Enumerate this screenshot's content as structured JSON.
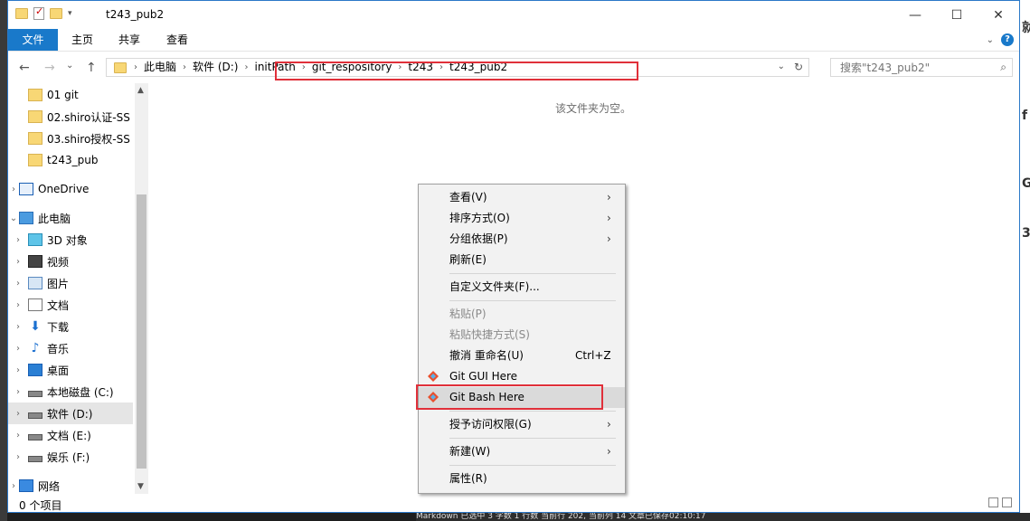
{
  "window": {
    "title": "t243_pub2",
    "controls": {
      "minimize": "—",
      "maximize": "☐",
      "close": "✕"
    }
  },
  "ribbon": {
    "tabs": [
      "文件",
      "主页",
      "共享",
      "查看"
    ],
    "expand_icon": "chevron-down-icon",
    "help_icon": "?"
  },
  "nav": {
    "back": "←",
    "forward": "→",
    "recent": "⌄",
    "up": "↑"
  },
  "address": {
    "crumbs": [
      "此电脑",
      "软件 (D:)",
      "initPath",
      "git_respository",
      "t243",
      "t243_pub2"
    ],
    "highlight_color": "#e0303a"
  },
  "search": {
    "placeholder": "搜索\"t243_pub2\""
  },
  "navpane": {
    "items": [
      {
        "label": "01 git",
        "icon": "folder-icon"
      },
      {
        "label": "02.shiro认证-SS",
        "icon": "folder-icon"
      },
      {
        "label": "03.shiro授权-SS",
        "icon": "folder-icon"
      },
      {
        "label": "t243_pub",
        "icon": "folder-icon"
      },
      {
        "label": "OneDrive",
        "icon": "cloud-icon"
      },
      {
        "label": "此电脑",
        "icon": "computer-icon"
      },
      {
        "label": "3D 对象",
        "icon": "3d-objects-icon"
      },
      {
        "label": "视频",
        "icon": "video-icon"
      },
      {
        "label": "图片",
        "icon": "pictures-icon"
      },
      {
        "label": "文档",
        "icon": "documents-icon"
      },
      {
        "label": "下载",
        "icon": "download-icon"
      },
      {
        "label": "音乐",
        "icon": "music-icon"
      },
      {
        "label": "桌面",
        "icon": "desktop-icon"
      },
      {
        "label": "本地磁盘 (C:)",
        "icon": "drive-icon"
      },
      {
        "label": "软件 (D:)",
        "icon": "drive-icon"
      },
      {
        "label": "文档 (E:)",
        "icon": "drive-icon"
      },
      {
        "label": "娱乐 (F:)",
        "icon": "drive-icon"
      },
      {
        "label": "网络",
        "icon": "network-icon"
      }
    ]
  },
  "content": {
    "empty_text": "该文件夹为空。"
  },
  "status": {
    "item_count": "0 个项目"
  },
  "context_menu": {
    "view": "查看(V)",
    "sort": "排序方式(O)",
    "group": "分组依据(P)",
    "refresh": "刷新(E)",
    "customize": "自定义文件夹(F)...",
    "paste": "粘贴(P)",
    "paste_shortcut": "粘贴快捷方式(S)",
    "undo_rename": "撤消 重命名(U)",
    "undo_shortcut": "Ctrl+Z",
    "git_gui": "Git GUI Here",
    "git_bash": "Git Bash Here",
    "give_access": "授予访问权限(G)",
    "new": "新建(W)",
    "properties": "属性(R)"
  },
  "background": {
    "statusbar_text": "Markdown 已选中  3 字数  1 行数  当前行 202, 当前列 14  文章已保存02:10:17"
  }
}
